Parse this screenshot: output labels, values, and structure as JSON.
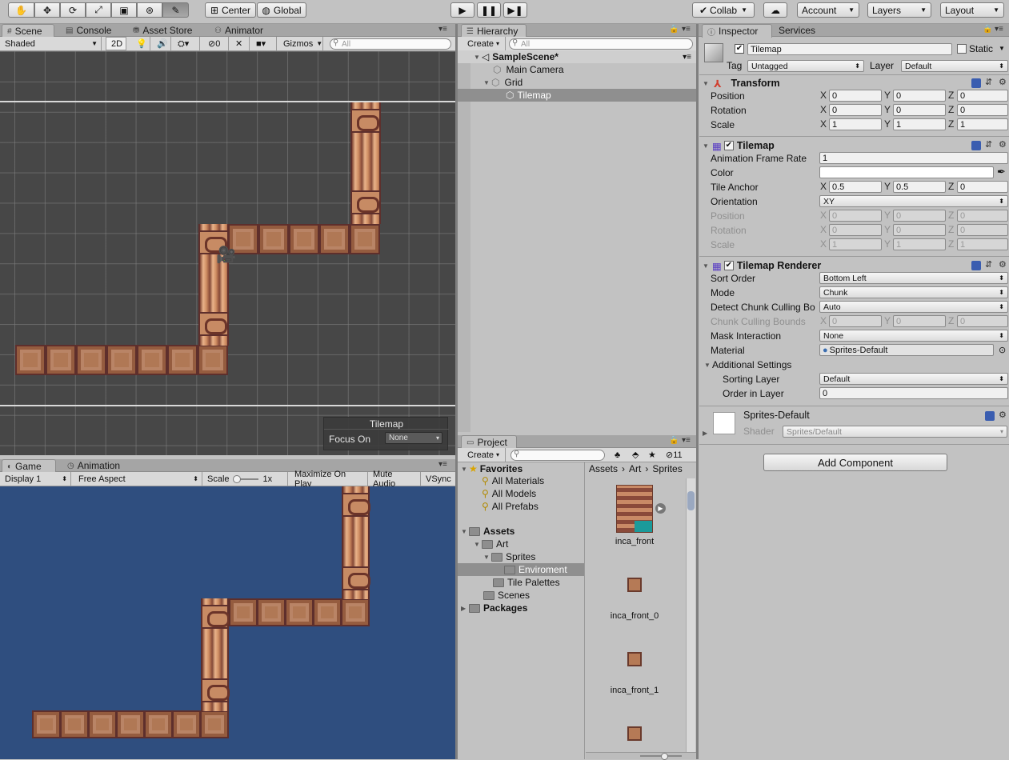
{
  "toolbar": {
    "pivot_mode": "Center",
    "pivot_rotation": "Global",
    "collab": "Collab",
    "account": "Account",
    "layers": "Layers",
    "layout": "Layout"
  },
  "scene_panel": {
    "tabs": [
      "Scene",
      "Console",
      "Asset Store",
      "Animator"
    ],
    "shading_mode": "Shaded",
    "mode_2d": "2D",
    "fx_count": "0",
    "gizmos": "Gizmos",
    "search_placeholder": "All",
    "overlay_title": "Tilemap",
    "focus_on_label": "Focus On",
    "focus_on_value": "None"
  },
  "game_panel": {
    "tabs": [
      "Game",
      "Animation"
    ],
    "display": "Display 1",
    "aspect": "Free Aspect",
    "scale_label": "Scale",
    "scale_value": "1x",
    "maximize": "Maximize On Play",
    "mute": "Mute Audio",
    "vsync": "VSync"
  },
  "hierarchy": {
    "tab": "Hierarchy",
    "create": "Create",
    "search_placeholder": "All",
    "scene": "SampleScene*",
    "items": [
      "Main Camera",
      "Grid",
      "Tilemap"
    ]
  },
  "project": {
    "tab": "Project",
    "create": "Create",
    "badge_count": "11",
    "favorites_label": "Favorites",
    "favorites": [
      "All Materials",
      "All Models",
      "All Prefabs"
    ],
    "assets_label": "Assets",
    "tree": [
      "Art",
      "Sprites",
      "Enviroment",
      "Tile Palettes",
      "Scenes"
    ],
    "packages_label": "Packages",
    "breadcrumb": [
      "Assets",
      "Art",
      "Sprites"
    ],
    "assets": [
      "inca_front",
      "inca_front_0",
      "inca_front_1"
    ]
  },
  "inspector": {
    "tabs": [
      "Inspector",
      "Services"
    ],
    "object_name": "Tilemap",
    "static_label": "Static",
    "tag_label": "Tag",
    "tag_value": "Untagged",
    "layer_label": "Layer",
    "layer_value": "Default",
    "transform": {
      "title": "Transform",
      "position_label": "Position",
      "position": [
        "0",
        "0",
        "0"
      ],
      "rotation_label": "Rotation",
      "rotation": [
        "0",
        "0",
        "0"
      ],
      "scale_label": "Scale",
      "scale": [
        "1",
        "1",
        "1"
      ]
    },
    "tilemap": {
      "title": "Tilemap",
      "frame_rate_label": "Animation Frame Rate",
      "frame_rate": "1",
      "color_label": "Color",
      "anchor_label": "Tile Anchor",
      "anchor": [
        "0.5",
        "0.5",
        "0"
      ],
      "orientation_label": "Orientation",
      "orientation": "XY",
      "position_label": "Position",
      "position": [
        "0",
        "0",
        "0"
      ],
      "rotation_label": "Rotation",
      "rotation": [
        "0",
        "0",
        "0"
      ],
      "scale_label": "Scale",
      "scale": [
        "1",
        "1",
        "1"
      ]
    },
    "renderer": {
      "title": "Tilemap Renderer",
      "sort_order_label": "Sort Order",
      "sort_order": "Bottom Left",
      "mode_label": "Mode",
      "mode": "Chunk",
      "detect_label": "Detect Chunk Culling Bo",
      "detect": "Auto",
      "bounds_label": "Chunk Culling Bounds",
      "bounds": [
        "0",
        "0",
        "0"
      ],
      "mask_label": "Mask Interaction",
      "mask": "None",
      "material_label": "Material",
      "material": "Sprites-Default",
      "additional_label": "Additional Settings",
      "sorting_layer_label": "Sorting Layer",
      "sorting_layer": "Default",
      "order_label": "Order in Layer",
      "order": "0"
    },
    "material": {
      "name": "Sprites-Default",
      "shader_label": "Shader",
      "shader": "Sprites/Default"
    },
    "add_component": "Add Component"
  }
}
